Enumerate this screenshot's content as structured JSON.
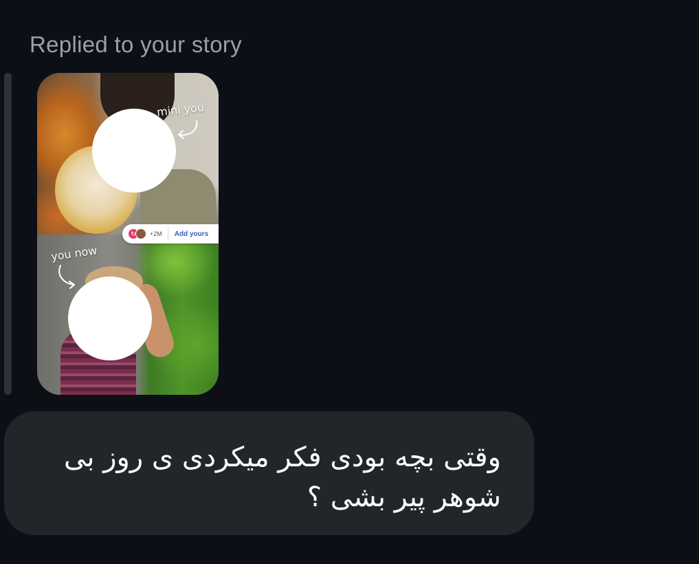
{
  "reply_header": {
    "label": "Replied to your story"
  },
  "story": {
    "top_caption": "mini you",
    "bottom_caption": "you now",
    "add_yours": {
      "count": "+2M",
      "label": "Add yours"
    }
  },
  "message": {
    "text": "وقتی بچه بودی فکر میکردی ی روز بی شوهر پیر بشی ؟"
  },
  "colors": {
    "background": "#0c1016",
    "bubble": "#22262b",
    "label_text": "#9aa1ab",
    "add_yours_accent": "#3b57c4",
    "add_yours_icon": "#e8356b"
  }
}
